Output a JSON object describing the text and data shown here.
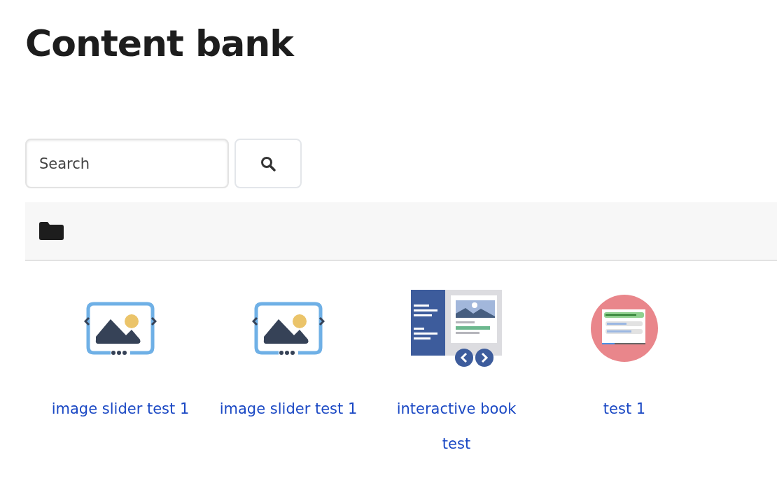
{
  "page": {
    "title": "Content bank"
  },
  "search": {
    "placeholder": "Search"
  },
  "items": [
    {
      "kind": "image-slider",
      "name": "image slider test 1"
    },
    {
      "kind": "image-slider",
      "name": "image slider test 1"
    },
    {
      "kind": "interactive-book",
      "name": "interactive book test"
    },
    {
      "kind": "quiz",
      "name": "test 1"
    }
  ]
}
